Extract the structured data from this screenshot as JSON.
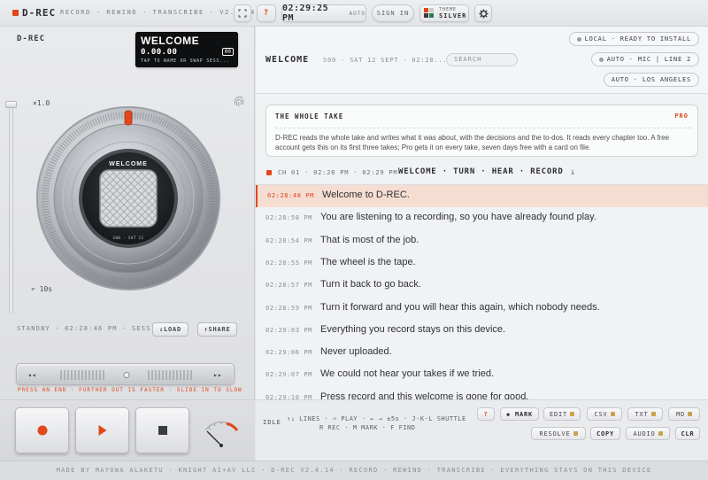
{
  "topbar": {
    "brand": "D-REC",
    "tagline": "RECORD · REWIND · TRANSCRIBE · V2.4.14",
    "help_label": "?",
    "clock": "02:29:25 PM",
    "clock_mode": "AUTO",
    "sign_in_label": "SIGN IN",
    "theme_label": "THEME",
    "theme_value": "SILVER",
    "icons": {
      "fullscreen": "fullscreen-icon",
      "settings": "gear-icon"
    }
  },
  "deck": {
    "title": "D-REC",
    "display": {
      "take_name": "WELCOME",
      "time": "0.00.00",
      "badge": "00",
      "hint": "TAP TO NAME OR SWAP SESS..."
    },
    "speed": "×1.0",
    "rewind_hint": "↶ 10s",
    "wheel_label": "WELCOME",
    "wheel_sub": "S00 · SAT 12",
    "status": "STANDBY · 02:28:46 PM · SESS...",
    "load_label": "↓LOAD",
    "share_label": "↑SHARE",
    "shuttle_hint": "PRESS AN END · FURTHER OUT IS FASTER · SLIDE IN TO SLOW",
    "colors": {
      "accent": "#e0481c"
    }
  },
  "header": {
    "take_title": "WELCOME",
    "take_meta": "S00 · SAT 12 SEPT · 02:28...",
    "search_placeholder": "SEARCH",
    "status_pills": [
      "LOCAL · READY TO INSTALL",
      "AUTO · MIC | LINE 2",
      "AUTO · LOS ANGELES"
    ]
  },
  "summary": {
    "title": "THE WHOLE TAKE",
    "tier": "PRO",
    "body": "D-REC reads the whole take and writes what it was about, with the decisions and the to-dos. It reads every chapter too. A free account gets this on its first three takes; Pro gets it on every take, seven days free with a card on file."
  },
  "chapter": {
    "meta": "CH 01 · 02:28 PM · 02:29 PM",
    "title": "WELCOME · TURN · HEAR · RECORD",
    "arrow": "↓"
  },
  "transcript": [
    {
      "time": "02:28:48 PM",
      "text": "Welcome to D-REC.",
      "active": true
    },
    {
      "time": "02:28:50 PM",
      "text": "You are listening to a recording, so you have already found play."
    },
    {
      "time": "02:28:54 PM",
      "text": "That is most of the job."
    },
    {
      "time": "02:28:55 PM",
      "text": "The wheel is the tape."
    },
    {
      "time": "02:28:57 PM",
      "text": "Turn it back to go back."
    },
    {
      "time": "02:28:59 PM",
      "text": "Turn it forward and you will hear this again, which nobody needs."
    },
    {
      "time": "02:29:03 PM",
      "text": "Everything you record stays on this device."
    },
    {
      "time": "02:29:06 PM",
      "text": "Never uploaded."
    },
    {
      "time": "02:29:07 PM",
      "text": "We could not hear your takes if we tried."
    },
    {
      "time": "02:29:10 PM",
      "text": "Press record and this welcome is gone for good."
    }
  ],
  "toolbar": {
    "state": "IDLE",
    "shortcuts_line1": "↑↓ LINES · ⏎ PLAY · ← → ±5s · J·K·L SHUTTLE",
    "shortcuts_line2": "R REC · M MARK · F FIND",
    "help": "?",
    "mark": "◆ MARK",
    "edit": "EDIT",
    "csv": "CSV",
    "txt": "TXT",
    "md": "MD",
    "resolve": "RESOLVE",
    "copy": "COPY",
    "audio": "AUDIO",
    "clr": "CLR"
  },
  "footer": {
    "text": "MADE BY MAYOWA ALAKETU · KNIGHT AI+AV LLC · D-REC V2.4.14 · RECORD · REWIND · TRANSCRIBE · EVERYTHING STAYS ON THIS DEVICE"
  }
}
